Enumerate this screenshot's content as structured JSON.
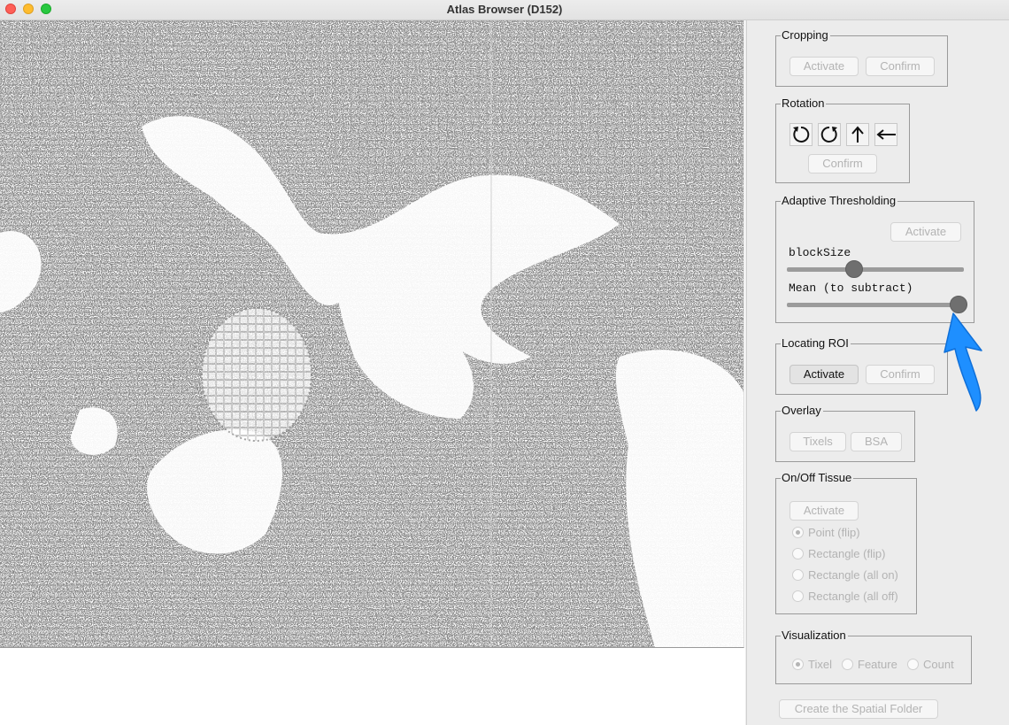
{
  "window": {
    "title": "Atlas Browser (D152)"
  },
  "cropping": {
    "label": "Cropping",
    "activate": "Activate",
    "confirm": "Confirm"
  },
  "rotation": {
    "label": "Rotation",
    "confirm": "Confirm",
    "buttons": [
      "rotate-left-icon",
      "rotate-right-icon",
      "arrow-up-icon",
      "arrow-left-icon"
    ]
  },
  "adaptive_thresholding": {
    "label": "Adaptive Thresholding",
    "activate": "Activate",
    "block_size": {
      "label": "blockSize",
      "value_fraction": 0.38
    },
    "mean": {
      "label": "Mean (to subtract)",
      "value_fraction": 0.97
    }
  },
  "locating_roi": {
    "label": "Locating ROI",
    "activate": "Activate",
    "confirm": "Confirm"
  },
  "overlay": {
    "label": "Overlay",
    "tixels": "Tixels",
    "bsa": "BSA"
  },
  "on_off_tissue": {
    "label": "On/Off Tissue",
    "activate": "Activate",
    "options": [
      "Point (flip)",
      "Rectangle (flip)",
      "Rectangle (all on)",
      "Rectangle (all off)"
    ],
    "selected": "Point (flip)"
  },
  "visualization": {
    "label": "Visualization",
    "options": [
      "Tixel",
      "Feature",
      "Count"
    ],
    "selected": "Tixel"
  },
  "create_folder": "Create the Spatial Folder",
  "colors": {
    "accent_pointer": "#1e8fff",
    "close": "#fe5f57",
    "minimize": "#febc2e",
    "maximize": "#28c840"
  }
}
